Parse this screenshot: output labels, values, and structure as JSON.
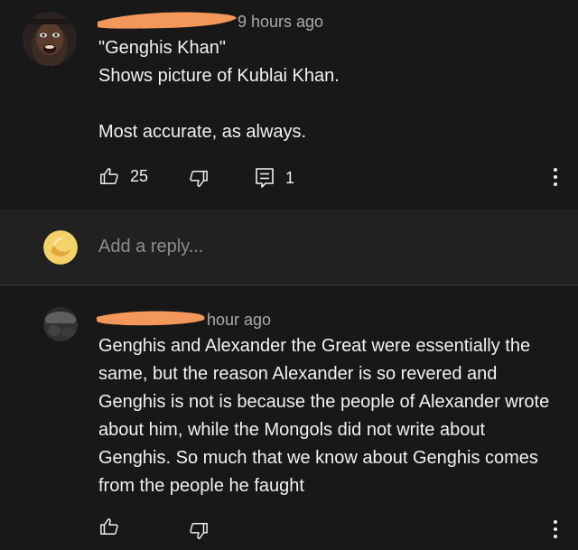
{
  "comments": [
    {
      "author": "",
      "time": "9 hours ago",
      "body": "\"Genghis Khan\"\nShows picture of Kublai Khan.\n\nMost accurate, as always.",
      "likes": "25",
      "replies": "1",
      "icons": {
        "like": "thumbs-up-icon",
        "dislike": "thumbs-down-icon",
        "reply": "reply-icon",
        "more": "more-options-icon"
      }
    },
    {
      "author": "",
      "time": "hour ago",
      "body": "Genghis and Alexander the Great were essentially the same, but the reason Alexander is so revered and Genghis is not is because the people of Alexander wrote about him, while the Mongols did not write about Genghis. So much that we know about Genghis comes from the people he faught",
      "icons": {
        "like": "thumbs-up-icon",
        "dislike": "thumbs-down-icon",
        "more": "more-options-icon"
      }
    }
  ],
  "reply_box": {
    "placeholder": "Add a reply..."
  },
  "colors": {
    "background": "#181818",
    "reply_bar": "#212121",
    "text": "#f1f1f1",
    "meta_text": "#aaaaaa",
    "redaction": "#f4975a",
    "user_avatar": "#f3d26a"
  }
}
